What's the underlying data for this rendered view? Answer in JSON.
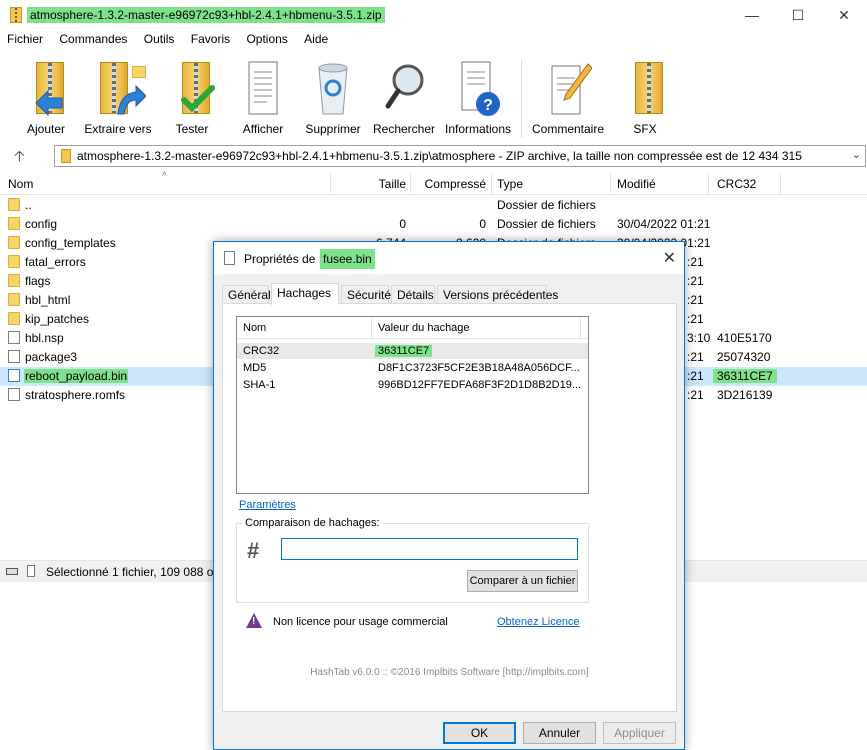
{
  "window": {
    "title": "atmosphere-1.3.2-master-e96972c93+hbl-2.4.1+hbmenu-3.5.1.zip",
    "controls": [
      "—",
      "☐",
      "✕"
    ]
  },
  "menu": [
    "Fichier",
    "Commandes",
    "Outils",
    "Favoris",
    "Options",
    "Aide"
  ],
  "toolbar": [
    {
      "label": "Ajouter",
      "icon": "add-archive-icon"
    },
    {
      "label": "Extraire vers",
      "icon": "extract-icon"
    },
    {
      "label": "Tester",
      "icon": "test-icon"
    },
    {
      "label": "Afficher",
      "icon": "view-icon"
    },
    {
      "label": "Supprimer",
      "icon": "delete-icon"
    },
    {
      "label": "Rechercher",
      "icon": "find-icon"
    },
    {
      "label": "Informations",
      "icon": "info-icon"
    },
    {
      "label": "Commentaire",
      "icon": "comment-icon"
    },
    {
      "label": "SFX",
      "icon": "sfx-icon"
    }
  ],
  "address": {
    "up_glyph": "🡡",
    "text": "atmosphere-1.3.2-master-e96972c93+hbl-2.4.1+hbmenu-3.5.1.zip\\atmosphere - ZIP archive, la taille non compressée est de 12 434 315",
    "dropdown": "⌄"
  },
  "columns": {
    "name": "Nom",
    "size": "Taille",
    "packed": "Compressé",
    "type": "Type",
    "modified": "Modifié",
    "crc": "CRC32"
  },
  "files": [
    {
      "name": "..",
      "kind": "folder",
      "size": "",
      "packed": "",
      "type": "Dossier de fichiers",
      "modified": "",
      "crc": ""
    },
    {
      "name": "config",
      "kind": "folder",
      "size": "0",
      "packed": "0",
      "type": "Dossier de fichiers",
      "modified": "30/04/2022 01:21",
      "crc": ""
    },
    {
      "name": "config_templates",
      "kind": "folder",
      "size": "6 744",
      "packed": "2 620",
      "type": "Dossier de fichiers",
      "modified": "30/04/2022 01:21",
      "crc": ""
    },
    {
      "name": "fatal_errors",
      "kind": "folder",
      "size": "",
      "packed": "",
      "type": "",
      "modified": ":21",
      "crc": ""
    },
    {
      "name": "flags",
      "kind": "folder",
      "size": "",
      "packed": "",
      "type": "",
      "modified": ":21",
      "crc": ""
    },
    {
      "name": "hbl_html",
      "kind": "folder",
      "size": "",
      "packed": "",
      "type": "",
      "modified": ":21",
      "crc": ""
    },
    {
      "name": "kip_patches",
      "kind": "folder",
      "size": "",
      "packed": "",
      "type": "",
      "modified": ":21",
      "crc": ""
    },
    {
      "name": "hbl.nsp",
      "kind": "file",
      "size": "",
      "packed": "",
      "type": "",
      "modified": "3:10",
      "crc": "410E5170"
    },
    {
      "name": "package3",
      "kind": "file",
      "size": "",
      "packed": "",
      "type": "",
      "modified": ":21",
      "crc": "25074320"
    },
    {
      "name": "reboot_payload.bin",
      "kind": "file",
      "size": "",
      "packed": "",
      "type": "",
      "modified": ":21",
      "crc": "36311CE7",
      "selected": true
    },
    {
      "name": "stratosphere.romfs",
      "kind": "file",
      "size": "",
      "packed": "",
      "type": "",
      "modified": ":21",
      "crc": "3D216139"
    }
  ],
  "status": {
    "text": "Sélectionné 1 fichier, 109 088 oc"
  },
  "dialog": {
    "title_prefix": "Propriétés de :",
    "title_file": "fusee.bin",
    "close_glyph": "✕",
    "tabs": [
      "Général",
      "Hachages",
      "Sécurité",
      "Détails",
      "Versions précédentes"
    ],
    "active_tab": 1,
    "hash_header": {
      "name": "Nom",
      "value": "Valeur du hachage"
    },
    "hashes": [
      {
        "name": "CRC32",
        "value": "36311CE7"
      },
      {
        "name": "MD5",
        "value": "D8F1C3723F5CF2E3B18A48A056DCF..."
      },
      {
        "name": "SHA-1",
        "value": "996BD12FF7EDFA68F3F2D1D8B2D19..."
      }
    ],
    "params_link": "Paramètres",
    "compare": {
      "legend": "Comparaison de hachages:",
      "input_value": "",
      "hash_glyph": "#",
      "button": "Comparer à un fichier"
    },
    "license": {
      "text": "Non licence pour usage commercial",
      "link": "Obtenez Licence"
    },
    "footer": "HashTab v6.0.0 :: ©2016 Implbits Software [http://implbits.com]",
    "buttons": {
      "ok": "OK",
      "cancel": "Annuler",
      "apply": "Appliquer"
    }
  }
}
